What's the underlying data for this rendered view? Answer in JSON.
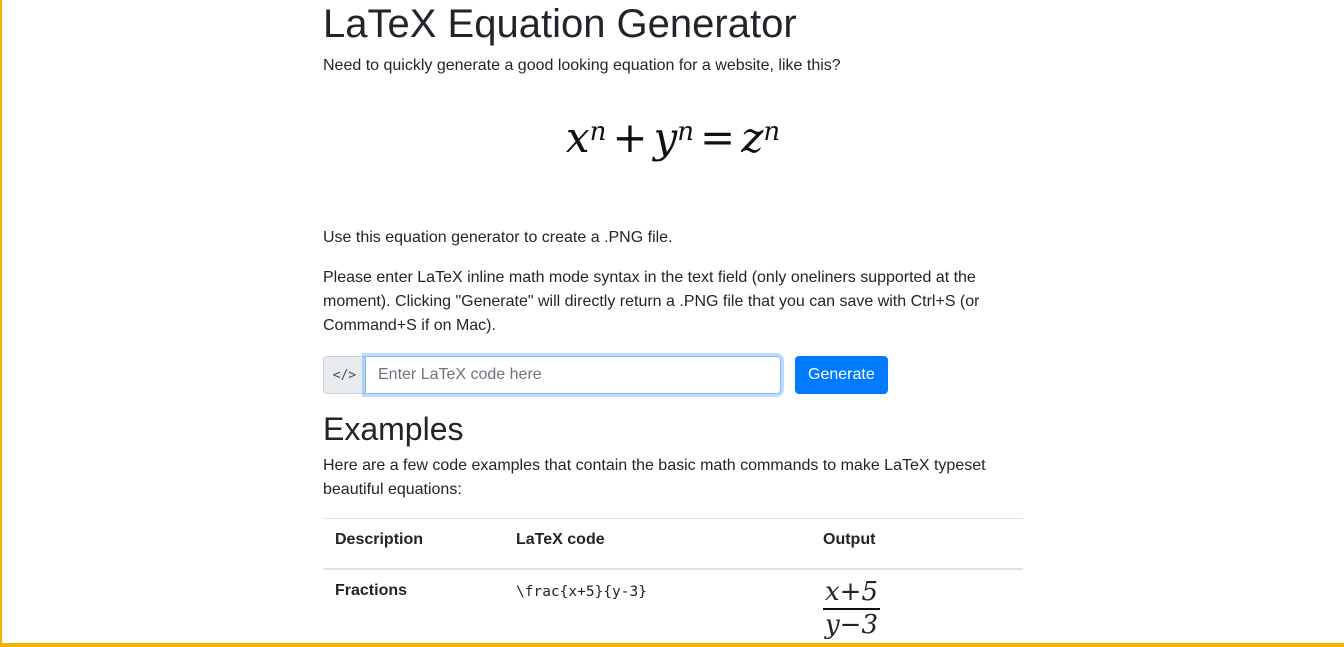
{
  "page": {
    "title": "LaTeX Equation Generator",
    "intro": "Need to quickly generate a good looking equation for a website, like this?",
    "hero_equation": {
      "a": "x",
      "a_exp": "n",
      "plus": "+",
      "b": "y",
      "b_exp": "n",
      "eq": "=",
      "c": "z",
      "c_exp": "n"
    },
    "use_text": "Use this equation generator to create a .PNG file.",
    "please_text": "Please enter LaTeX inline math mode syntax in the text field (only oneliners supported at the moment). Clicking \"Generate\" will directly return a .PNG file that you can save with Ctrl+S (or Command+S if on Mac)."
  },
  "form": {
    "addon_icon": "code-icon",
    "addon_glyph": "</>",
    "input_value": "",
    "input_placeholder": "Enter LaTeX code here",
    "generate_label": "Generate",
    "accent_color": "#007bff"
  },
  "examples": {
    "heading": "Examples",
    "description": "Here are a few code examples that contain the basic math commands to make LaTeX typeset beautiful equations:",
    "columns": [
      "Description",
      "LaTeX code",
      "Output"
    ],
    "rows": [
      {
        "description": "Fractions",
        "code": "\\frac{x+5}{y-3}",
        "output_numerator": "x+5",
        "output_denominator": "y−3"
      }
    ]
  }
}
